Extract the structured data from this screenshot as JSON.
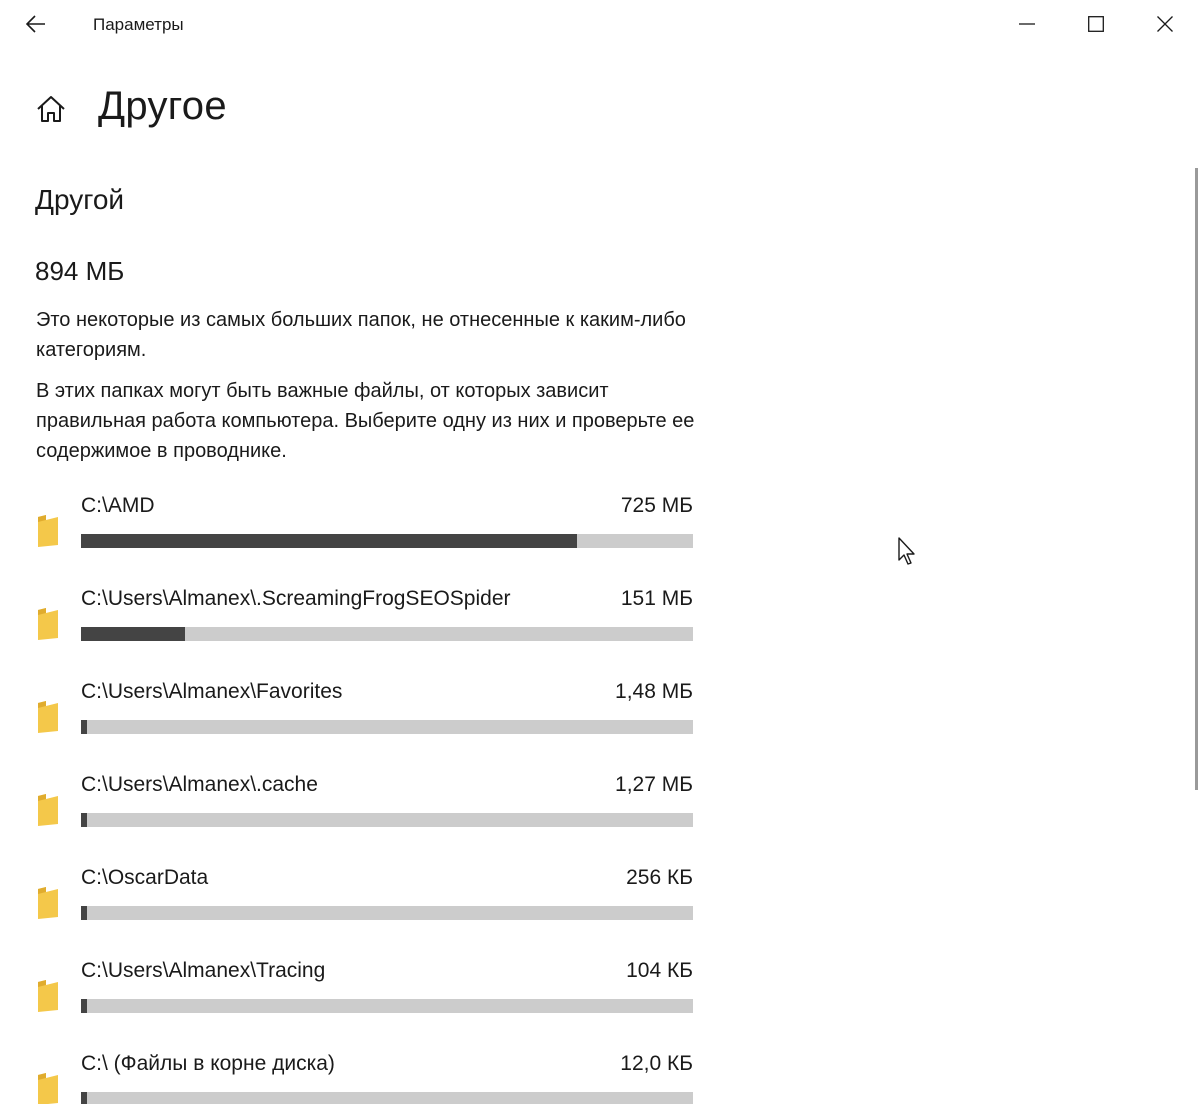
{
  "window": {
    "title": "Параметры",
    "back_icon": "back-arrow-icon",
    "minimize_icon": "minimize-icon",
    "maximize_icon": "maximize-icon",
    "close_icon": "close-icon"
  },
  "header": {
    "home_icon": "home-icon",
    "page_title": "Другое"
  },
  "section": {
    "heading": "Другой",
    "total_size": "894 МБ",
    "paragraph1": "Это некоторые из самых больших папок, не отнесенные к каким-либо категориям.",
    "paragraph2": "В этих папках могут быть важные файлы, от которых зависит правильная работа компьютера. Выберите одну из них и проверьте ее содержимое в проводнике."
  },
  "colors": {
    "bar_fill": "#444444",
    "bar_track": "#cccccc",
    "folder": "#f4c84a"
  },
  "folders": [
    {
      "path": "C:\\AMD",
      "size": "725 МБ",
      "fraction": 0.81
    },
    {
      "path": "C:\\Users\\Almanex\\.ScreamingFrogSEOSpider",
      "size": "151 МБ",
      "fraction": 0.17
    },
    {
      "path": "C:\\Users\\Almanex\\Favorites",
      "size": "1,48 МБ",
      "fraction": 0.01
    },
    {
      "path": "C:\\Users\\Almanex\\.cache",
      "size": "1,27 МБ",
      "fraction": 0.01
    },
    {
      "path": "C:\\OscarData",
      "size": "256 КБ",
      "fraction": 0.01
    },
    {
      "path": "C:\\Users\\Almanex\\Tracing",
      "size": "104 КБ",
      "fraction": 0.01
    },
    {
      "path": "C:\\ (Файлы в корне диска)",
      "size": "12,0 КБ",
      "fraction": 0.01
    }
  ]
}
